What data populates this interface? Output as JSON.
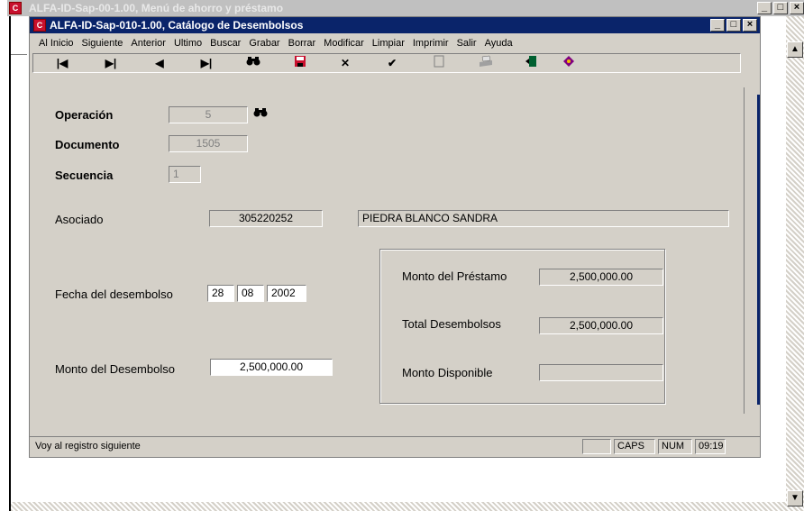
{
  "outer_window": {
    "title": "ALFA-ID-Sap-00-1.00, Menú de ahorro y préstamo"
  },
  "inner_window": {
    "title": "ALFA-ID-Sap-010-1.00, Catálogo de Desembolsos"
  },
  "menu": [
    "Al Inicio",
    "Siguiente",
    "Anterior",
    "Ultimo",
    "Buscar",
    "Grabar",
    "Borrar",
    "Modificar",
    "Limpiar",
    "Imprimir",
    "Salir",
    "Ayuda"
  ],
  "toolbar": [
    {
      "icon": "first-record-icon",
      "glyph": "⏮"
    },
    {
      "icon": "next-record-icon",
      "glyph": "▶"
    },
    {
      "icon": "previous-record-icon",
      "glyph": "◀"
    },
    {
      "icon": "last-record-icon",
      "glyph": "⏭"
    },
    {
      "icon": "search-binoculars-icon",
      "glyph": "🔍"
    },
    {
      "icon": "save-floppy-icon",
      "glyph": "■"
    },
    {
      "icon": "delete-x-icon",
      "glyph": "✕"
    },
    {
      "icon": "modify-check-icon",
      "glyph": "✔"
    },
    {
      "icon": "clear-icon",
      "glyph": "▭"
    },
    {
      "icon": "print-icon",
      "glyph": "⎙"
    },
    {
      "icon": "exit-door-icon",
      "glyph": "⇥"
    },
    {
      "icon": "help-book-icon",
      "glyph": "◆"
    }
  ],
  "form": {
    "operacion_label": "Operación",
    "operacion_value": "5",
    "documento_label": "Documento",
    "documento_value": "1505",
    "secuencia_label": "Secuencia",
    "secuencia_value": "1",
    "asociado_label": "Asociado",
    "asociado_id": "305220252",
    "asociado_nombre": "PIEDRA BLANCO SANDRA",
    "fecha_label": "Fecha del desembolso",
    "fecha_dia": "28",
    "fecha_mes": "08",
    "fecha_anio": "2002",
    "monto_desembolso_label": "Monto del Desembolso",
    "monto_desembolso_value": "2,500,000.00"
  },
  "summary": {
    "monto_prestamo_label": "Monto del Préstamo",
    "monto_prestamo_value": "2,500,000.00",
    "total_desembolsos_label": "Total Desembolsos",
    "total_desembolsos_value": "2,500,000.00",
    "monto_disponible_label": "Monto Disponible",
    "monto_disponible_value": ""
  },
  "status": {
    "message": "Voy al registro siguiente",
    "caps": "CAPS",
    "num": "NUM",
    "time": "09:19"
  },
  "colors": {
    "titlebar": "#0a246a",
    "face": "#d4d0c8"
  }
}
